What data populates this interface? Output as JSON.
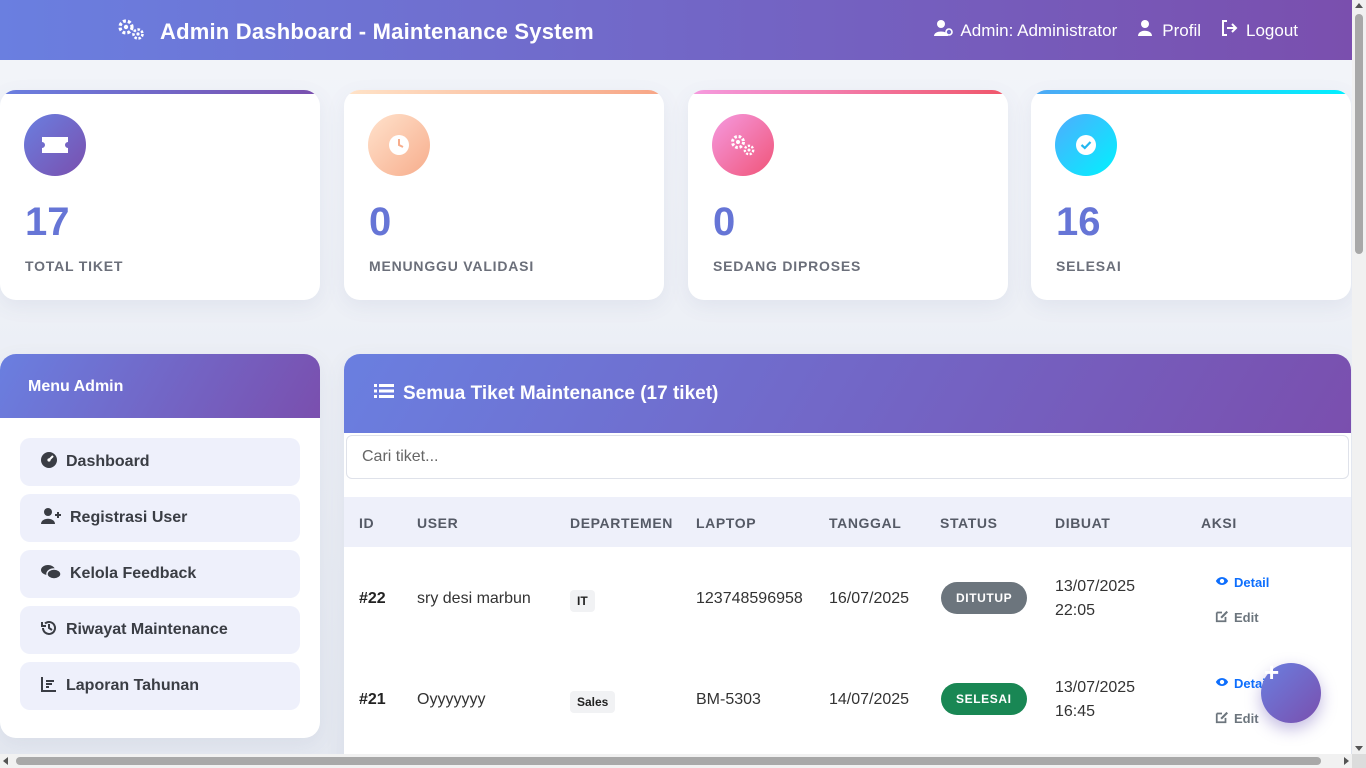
{
  "header": {
    "title": "Admin Dashboard - Maintenance System",
    "nav": [
      {
        "label": "Admin: Administrator",
        "icon": "user-cog-icon"
      },
      {
        "label": "Profil",
        "icon": "user-icon"
      },
      {
        "label": "Logout",
        "icon": "logout-icon"
      }
    ]
  },
  "stats": [
    {
      "value": "17",
      "label": "TOTAL TIKET",
      "icon": "ticket-icon",
      "color": "#6675d6"
    },
    {
      "value": "0",
      "label": "MENUNGGU VALIDASI",
      "icon": "clock-icon",
      "color": "#f7b08a"
    },
    {
      "value": "0",
      "label": "SEDANG DIPROSES",
      "icon": "gears-icon",
      "color": "#f0568a"
    },
    {
      "value": "16",
      "label": "SELESAI",
      "icon": "check-circle-icon",
      "color": "#23b7f0"
    }
  ],
  "sidebar": {
    "title": "Menu Admin",
    "items": [
      {
        "label": "Dashboard",
        "icon": "gauge-icon"
      },
      {
        "label": "Registrasi User",
        "icon": "user-plus-icon"
      },
      {
        "label": "Kelola Feedback",
        "icon": "comments-icon"
      },
      {
        "label": "Riwayat Maintenance",
        "icon": "history-icon"
      },
      {
        "label": "Laporan Tahunan",
        "icon": "chart-icon"
      }
    ]
  },
  "tickets": {
    "title": "Semua Tiket Maintenance (17 tiket)",
    "search_placeholder": "Cari tiket...",
    "columns": [
      "ID",
      "USER",
      "DEPARTEMEN",
      "LAPTOP",
      "TANGGAL",
      "STATUS",
      "DIBUAT",
      "AKSI"
    ],
    "rows": [
      {
        "id": "#22",
        "user": "sry desi marbun",
        "dept": "IT",
        "laptop": "123748596958",
        "tanggal": "16/07/2025",
        "status": "DITUTUP",
        "status_color": "#6c757d",
        "dibuat_date": "13/07/2025",
        "dibuat_time": "22:05",
        "detail": "Detail",
        "edit": "Edit"
      },
      {
        "id": "#21",
        "user": "Oyyyyyyy",
        "dept": "Sales",
        "laptop": "BM-5303",
        "tanggal": "14/07/2025",
        "status": "SELESAI",
        "status_color": "#198754",
        "dibuat_date": "13/07/2025",
        "dibuat_time": "16:45",
        "detail": "Detail",
        "edit": "Edit"
      }
    ]
  },
  "colors": {
    "accent_start": "#6a7fe0",
    "accent_end": "#7a4fae",
    "link": "#0d6efd"
  },
  "fab_label": "+"
}
